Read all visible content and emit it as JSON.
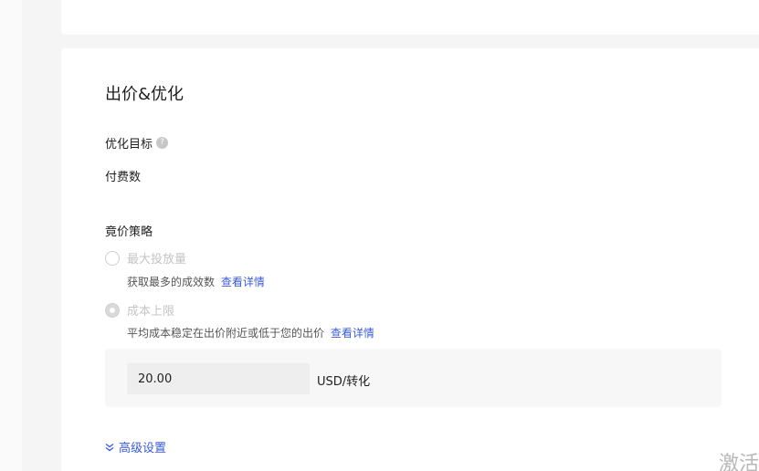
{
  "section": {
    "title": "出价&优化"
  },
  "optimization": {
    "label": "优化目标",
    "help_icon": "question-circle-icon",
    "value": "付费数"
  },
  "bidding": {
    "label": "竟价策略",
    "options": [
      {
        "label": "最大投放量",
        "description": "获取最多的成效数",
        "link": "查看详情",
        "selected": false
      },
      {
        "label": "成本上限",
        "description": "平均成本稳定在出价附近或低于您的出价",
        "link": "查看详情",
        "selected": true
      }
    ],
    "bid_value": "20.00",
    "bid_unit": "USD/转化"
  },
  "advanced": {
    "label": "高级设置",
    "icon": "double-chevron-down-icon"
  },
  "watermark": {
    "text": "激活"
  },
  "colors": {
    "link": "#3b5bd9",
    "disabled_text": "#c4c4c4",
    "panel_bg": "#f7f7f8"
  }
}
